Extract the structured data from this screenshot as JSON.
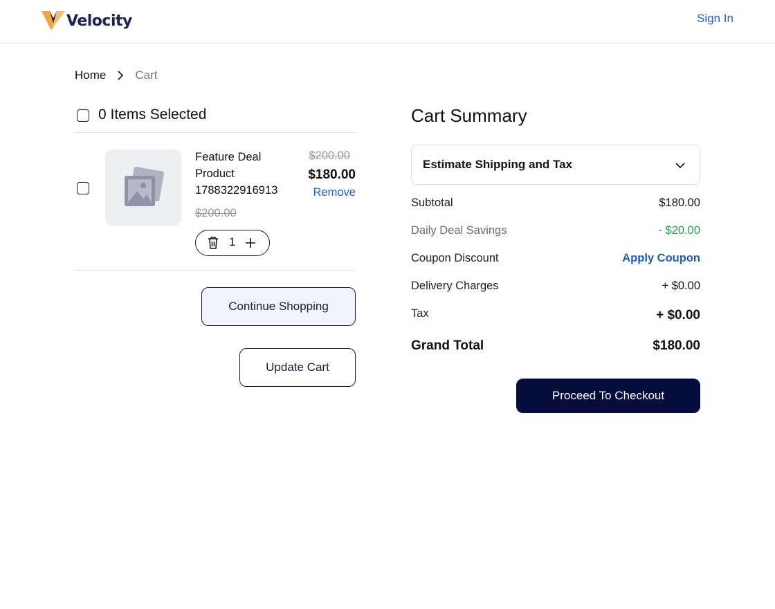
{
  "header": {
    "brand": "Velocity",
    "signin_label": "Sign In"
  },
  "breadcrumb": {
    "home": "Home",
    "current": "Cart"
  },
  "cart": {
    "select_label": "0 Items Selected",
    "items": [
      {
        "name": "Feature Deal Product 1788322916913",
        "unit_price_strike": "$200.00",
        "price_old": "$200.00",
        "price_new": "$180.00",
        "remove_label": "Remove",
        "quantity": "1"
      }
    ],
    "continue_label": "Continue Shopping",
    "update_label": "Update Cart"
  },
  "summary": {
    "title": "Cart Summary",
    "estimate_label": "Estimate Shipping and Tax",
    "subtotal_label": "Subtotal",
    "subtotal_value": "$180.00",
    "savings_label": "Daily Deal Savings",
    "savings_value": "- $20.00",
    "coupon_label": "Coupon Discount",
    "coupon_action": "Apply Coupon",
    "delivery_label": "Delivery Charges",
    "delivery_value": "+ $0.00",
    "tax_label": "Tax",
    "tax_value": "+ $0.00",
    "total_label": "Grand Total",
    "total_value": "$180.00",
    "checkout_label": "Proceed To Checkout"
  },
  "colors": {
    "accent": "#1f5fbf",
    "primary_button": "#060c3b",
    "savings": "#1f9a4a",
    "logo_orange": "#f4a340",
    "logo_navy": "#1a2255"
  },
  "icons": {
    "logo": "velocity-v-logo-icon",
    "breadcrumb_separator": "chevron-right-icon",
    "product_placeholder": "image-placeholder-icon",
    "quantity_decrease": "trash-icon",
    "quantity_increase": "plus-icon",
    "estimate_toggle": "chevron-down-icon"
  }
}
